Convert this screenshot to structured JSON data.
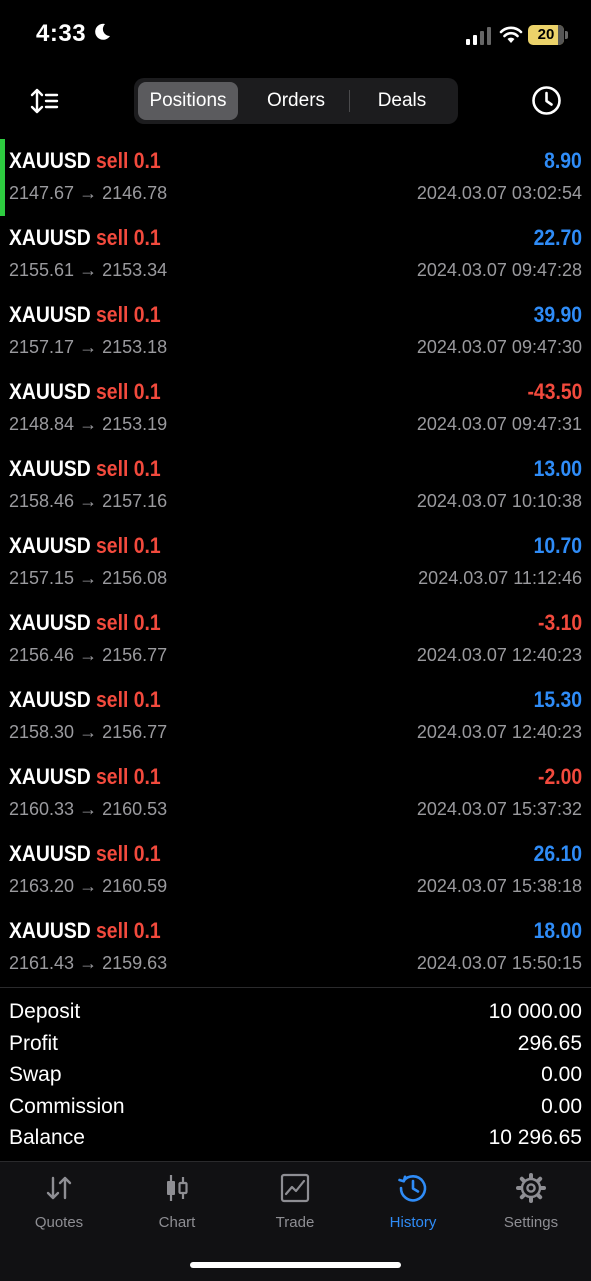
{
  "status_bar": {
    "time": "4:33",
    "battery": "20"
  },
  "tabs": [
    {
      "label": "Positions",
      "active": true
    },
    {
      "label": "Orders",
      "active": false
    },
    {
      "label": "Deals",
      "active": false
    }
  ],
  "positions": [
    {
      "symbol": "XAUUSD",
      "side": "sell 0.1",
      "prices": "2147.67 → 2146.78",
      "profit": "8.90",
      "positive": true,
      "datetime": "2024.03.07 03:02:54"
    },
    {
      "symbol": "XAUUSD",
      "side": "sell 0.1",
      "prices": "2155.61 → 2153.34",
      "profit": "22.70",
      "positive": true,
      "datetime": "2024.03.07 09:47:28"
    },
    {
      "symbol": "XAUUSD",
      "side": "sell 0.1",
      "prices": "2157.17 → 2153.18",
      "profit": "39.90",
      "positive": true,
      "datetime": "2024.03.07 09:47:30"
    },
    {
      "symbol": "XAUUSD",
      "side": "sell 0.1",
      "prices": "2148.84 → 2153.19",
      "profit": "-43.50",
      "positive": false,
      "datetime": "2024.03.07 09:47:31"
    },
    {
      "symbol": "XAUUSD",
      "side": "sell 0.1",
      "prices": "2158.46 → 2157.16",
      "profit": "13.00",
      "positive": true,
      "datetime": "2024.03.07 10:10:38"
    },
    {
      "symbol": "XAUUSD",
      "side": "sell 0.1",
      "prices": "2157.15 → 2156.08",
      "profit": "10.70",
      "positive": true,
      "datetime": "2024.03.07 11:12:46"
    },
    {
      "symbol": "XAUUSD",
      "side": "sell 0.1",
      "prices": "2156.46 → 2156.77",
      "profit": "-3.10",
      "positive": false,
      "datetime": "2024.03.07 12:40:23"
    },
    {
      "symbol": "XAUUSD",
      "side": "sell 0.1",
      "prices": "2158.30 → 2156.77",
      "profit": "15.30",
      "positive": true,
      "datetime": "2024.03.07 12:40:23"
    },
    {
      "symbol": "XAUUSD",
      "side": "sell 0.1",
      "prices": "2160.33 → 2160.53",
      "profit": "-2.00",
      "positive": false,
      "datetime": "2024.03.07 15:37:32"
    },
    {
      "symbol": "XAUUSD",
      "side": "sell 0.1",
      "prices": "2163.20 → 2160.59",
      "profit": "26.10",
      "positive": true,
      "datetime": "2024.03.07 15:38:18"
    },
    {
      "symbol": "XAUUSD",
      "side": "sell 0.1",
      "prices": "2161.43 → 2159.63",
      "profit": "18.00",
      "positive": true,
      "datetime": "2024.03.07 15:50:15"
    }
  ],
  "summary": [
    {
      "label": "Deposit",
      "value": "10 000.00"
    },
    {
      "label": "Profit",
      "value": "296.65"
    },
    {
      "label": "Swap",
      "value": "0.00"
    },
    {
      "label": "Commission",
      "value": "0.00"
    },
    {
      "label": "Balance",
      "value": "10 296.65"
    }
  ],
  "tab_bar": [
    {
      "label": "Quotes",
      "icon": "quotes-arrows-icon",
      "active": false
    },
    {
      "label": "Chart",
      "icon": "candlestick-icon",
      "active": false
    },
    {
      "label": "Trade",
      "icon": "trade-chart-icon",
      "active": false
    },
    {
      "label": "History",
      "icon": "history-clock-icon",
      "active": true
    },
    {
      "label": "Settings",
      "icon": "gear-icon",
      "active": false
    }
  ],
  "colors": {
    "profit_positive": "#2f8cf7",
    "profit_negative": "#f24a3d",
    "sell": "#f24a3d",
    "active_tab": "#2f8cf7",
    "selected_marker": "#2ecc40"
  }
}
